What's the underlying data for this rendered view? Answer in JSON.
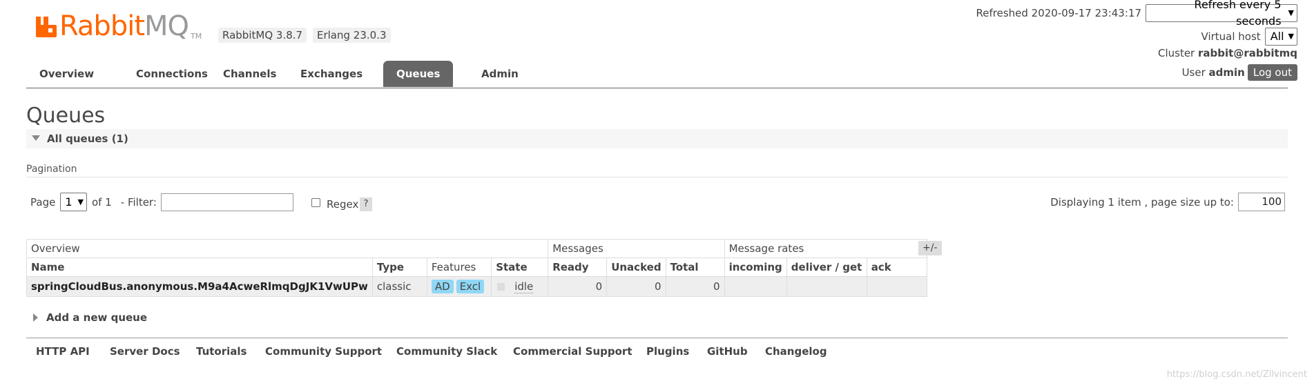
{
  "header": {
    "logo_text_rabbit": "Rabbit",
    "logo_text_mq": "MQ",
    "logo_tm": "TM",
    "version_rabbitmq": "RabbitMQ 3.8.7",
    "version_erlang": "Erlang 23.0.3",
    "refreshed_label": "Refreshed 2020-09-17 23:43:17",
    "refresh_select": "Refresh every 5 seconds",
    "virtual_host_label": "Virtual host",
    "virtual_host_value": "All",
    "cluster_label": "Cluster",
    "cluster_value": "rabbit@rabbitmq",
    "user_label": "User",
    "user_value": "admin",
    "logout_label": "Log out"
  },
  "tabs": [
    {
      "label": "Overview",
      "active": false
    },
    {
      "label": "Connections",
      "active": false
    },
    {
      "label": "Channels",
      "active": false
    },
    {
      "label": "Exchanges",
      "active": false
    },
    {
      "label": "Queues",
      "active": true
    },
    {
      "label": "Admin",
      "active": false
    }
  ],
  "page": {
    "title": "Queues",
    "section_title": "All queues (1)",
    "pagination_label": "Pagination",
    "page_label": "Page",
    "page_value": "1",
    "of_label": "of 1",
    "filter_label": "- Filter:",
    "filter_value": "",
    "regex_label": "Regex",
    "help_label": "?",
    "display_label": "Displaying 1 item , page size up to:",
    "page_size": "100",
    "toggle_columns": "+/-",
    "add_queue": "Add a new queue"
  },
  "table": {
    "groups": [
      "Overview",
      "Messages",
      "Message rates"
    ],
    "columns": [
      "Name",
      "Type",
      "Features",
      "State",
      "Ready",
      "Unacked",
      "Total",
      "incoming",
      "deliver / get",
      "ack"
    ],
    "rows": [
      {
        "name": "springCloudBus.anonymous.M9a4AcweRlmqDgJK1VwUPw",
        "type": "classic",
        "features": [
          "AD",
          "Excl"
        ],
        "state": "idle",
        "ready": "0",
        "unacked": "0",
        "total": "0",
        "incoming": "",
        "deliver_get": "",
        "ack": ""
      }
    ]
  },
  "footer": {
    "links": [
      "HTTP API",
      "Server Docs",
      "Tutorials",
      "Community Support",
      "Community Slack",
      "Commercial Support",
      "Plugins",
      "GitHub",
      "Changelog"
    ]
  },
  "watermark": "https://blog.csdn.net/Zllvincent",
  "colors": {
    "brand_orange": "#ff6600",
    "tab_active_bg": "#666666",
    "feature_badge": "#8fd7f5"
  }
}
